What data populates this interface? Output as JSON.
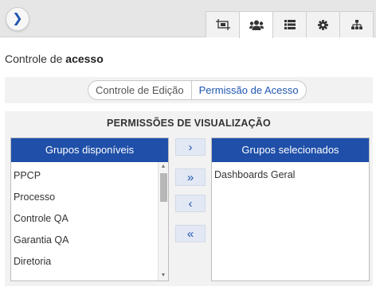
{
  "topbar": {
    "expand_icon": "chevron-right-icon",
    "tabs": [
      {
        "name": "layout-icon",
        "active": false
      },
      {
        "name": "users-icon",
        "active": true
      },
      {
        "name": "list-icon",
        "active": false
      },
      {
        "name": "gear-icon",
        "active": false
      },
      {
        "name": "sitemap-icon",
        "active": false
      }
    ]
  },
  "page": {
    "title_prefix": "Controle de ",
    "title_bold": "acesso"
  },
  "segmented": {
    "options": [
      "Controle de Edição",
      "Permissão de Acesso"
    ],
    "selected": "Permissão de Acesso"
  },
  "permissions": {
    "title": "PERMISSÕES DE VISUALIZAÇÃO",
    "available": {
      "header": "Grupos disponíveis",
      "items": [
        "PPCP",
        "Processo",
        "Controle QA",
        "Garantia QA",
        "Diretoria"
      ]
    },
    "selected": {
      "header": "Grupos selecionados",
      "items": [
        "Dashboards Geral"
      ]
    },
    "buttons": {
      "move_right": "›",
      "move_all_right": "»",
      "move_left": "‹",
      "move_all_left": "«"
    }
  },
  "colors": {
    "accent": "#1f56b0",
    "header_bg": "#1f4fa8",
    "button_bg": "#e2e8f4",
    "panel_bg": "#f2f2f2",
    "topbar_bg": "#e6e6e6"
  }
}
